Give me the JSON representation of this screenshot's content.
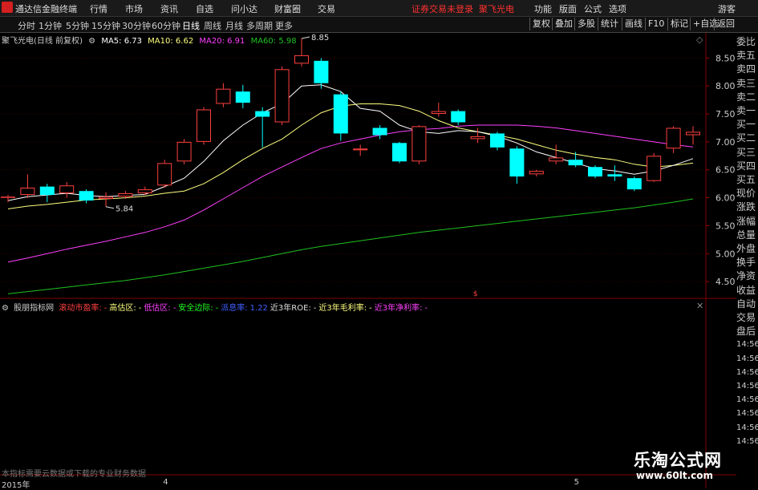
{
  "app": {
    "title": "通达信金融终端",
    "menu": [
      "行情",
      "市场",
      "资讯",
      "交易"
    ],
    "menu2": [
      "自选",
      "问小达",
      "财富圈",
      "交易"
    ],
    "warning": "证券交易未登录",
    "stock_name": "聚飞光电",
    "right_menu": [
      "功能",
      "版面",
      "公式",
      "选项"
    ],
    "guest": "游客"
  },
  "periods": {
    "items": [
      "分时",
      "1分钟",
      "5分钟",
      "15分钟",
      "30分钟",
      "60分钟",
      "日线",
      "周线",
      "月线",
      "多周期",
      "更多"
    ],
    "active": "日线"
  },
  "toolbar": {
    "buttons": [
      "复权",
      "叠加",
      "多股",
      "统计",
      "画线",
      "F10",
      "标记",
      "+自选",
      "返回"
    ]
  },
  "chart_header": {
    "name": "聚飞光电(日线 前复权)",
    "ma5": "MA5: 6.73",
    "ma10": "MA10: 6.62",
    "ma20": "MA20: 6.91",
    "ma60": "MA60: 5.98"
  },
  "colors": {
    "up": "#ff4040",
    "down": "#00ffff",
    "ma5": "#ffffff",
    "ma10": "#ffff80",
    "ma20": "#ff40ff",
    "ma60": "#20c020",
    "grid": "#400000"
  },
  "chart_data": {
    "type": "candlestick",
    "ylim": [
      4.2,
      8.95
    ],
    "yticks": [
      4.5,
      5.0,
      5.5,
      6.0,
      6.5,
      7.0,
      7.5,
      8.0,
      8.5
    ],
    "ytick_labels": [
      "4.50",
      "5.00",
      "5.50",
      "6.00",
      "6.50",
      "7.00",
      "7.50",
      "8.00",
      "8.50"
    ],
    "annotations": [
      {
        "text": "8.85",
        "index": 15,
        "value": 8.85
      },
      {
        "text": "5.84",
        "index": 5,
        "value": 5.84
      }
    ],
    "candles": [
      {
        "o": 6.0,
        "h": 6.05,
        "l": 5.92,
        "c": 6.02
      },
      {
        "o": 6.05,
        "h": 6.42,
        "l": 6.0,
        "c": 6.18
      },
      {
        "o": 6.2,
        "h": 6.25,
        "l": 5.92,
        "c": 6.05
      },
      {
        "o": 6.08,
        "h": 6.28,
        "l": 6.0,
        "c": 6.22
      },
      {
        "o": 6.12,
        "h": 6.15,
        "l": 5.9,
        "c": 5.95
      },
      {
        "o": 5.98,
        "h": 6.1,
        "l": 5.84,
        "c": 6.02
      },
      {
        "o": 6.02,
        "h": 6.12,
        "l": 5.98,
        "c": 6.08
      },
      {
        "o": 6.08,
        "h": 6.2,
        "l": 6.05,
        "c": 6.15
      },
      {
        "o": 6.22,
        "h": 6.68,
        "l": 6.18,
        "c": 6.62
      },
      {
        "o": 6.65,
        "h": 7.05,
        "l": 6.6,
        "c": 7.0
      },
      {
        "o": 7.0,
        "h": 7.62,
        "l": 6.95,
        "c": 7.58
      },
      {
        "o": 7.68,
        "h": 8.05,
        "l": 7.62,
        "c": 7.95
      },
      {
        "o": 7.9,
        "h": 8.02,
        "l": 7.6,
        "c": 7.7
      },
      {
        "o": 7.55,
        "h": 7.62,
        "l": 6.9,
        "c": 7.45
      },
      {
        "o": 7.35,
        "h": 8.35,
        "l": 7.3,
        "c": 8.3
      },
      {
        "o": 8.4,
        "h": 8.85,
        "l": 8.35,
        "c": 8.55
      },
      {
        "o": 8.45,
        "h": 8.5,
        "l": 7.95,
        "c": 8.05
      },
      {
        "o": 7.85,
        "h": 7.9,
        "l": 7.02,
        "c": 7.15
      },
      {
        "o": 6.85,
        "h": 6.95,
        "l": 6.75,
        "c": 6.88
      },
      {
        "o": 7.25,
        "h": 7.3,
        "l": 7.05,
        "c": 7.12
      },
      {
        "o": 6.98,
        "h": 7.0,
        "l": 6.62,
        "c": 6.65
      },
      {
        "o": 6.65,
        "h": 7.3,
        "l": 6.6,
        "c": 7.28
      },
      {
        "o": 7.5,
        "h": 7.7,
        "l": 7.45,
        "c": 7.55
      },
      {
        "o": 7.55,
        "h": 7.58,
        "l": 7.3,
        "c": 7.35
      },
      {
        "o": 7.05,
        "h": 7.25,
        "l": 6.98,
        "c": 7.1
      },
      {
        "o": 7.15,
        "h": 7.18,
        "l": 6.85,
        "c": 6.9
      },
      {
        "o": 6.88,
        "h": 6.92,
        "l": 6.25,
        "c": 6.38
      },
      {
        "o": 6.42,
        "h": 6.5,
        "l": 6.38,
        "c": 6.48
      },
      {
        "o": 6.65,
        "h": 6.95,
        "l": 6.6,
        "c": 6.72
      },
      {
        "o": 6.68,
        "h": 6.82,
        "l": 6.55,
        "c": 6.58
      },
      {
        "o": 6.55,
        "h": 6.58,
        "l": 6.35,
        "c": 6.38
      },
      {
        "o": 6.42,
        "h": 6.58,
        "l": 6.3,
        "c": 6.38
      },
      {
        "o": 6.35,
        "h": 6.38,
        "l": 6.12,
        "c": 6.15
      },
      {
        "o": 6.3,
        "h": 6.8,
        "l": 6.28,
        "c": 6.75
      },
      {
        "o": 6.88,
        "h": 7.28,
        "l": 6.8,
        "c": 7.25
      },
      {
        "o": 7.12,
        "h": 7.28,
        "l": 6.95,
        "c": 7.18
      }
    ],
    "ma5": [
      5.95,
      6.02,
      6.05,
      6.08,
      6.04,
      6.02,
      6.04,
      6.06,
      6.2,
      6.35,
      6.65,
      7.02,
      7.3,
      7.52,
      7.68,
      8.0,
      8.02,
      7.9,
      7.6,
      7.55,
      7.3,
      7.18,
      7.15,
      7.2,
      7.18,
      7.1,
      6.98,
      6.82,
      6.72,
      6.62,
      6.52,
      6.48,
      6.42,
      6.48,
      6.58,
      6.7
    ],
    "ma10": [
      5.8,
      5.85,
      5.88,
      5.92,
      5.96,
      5.98,
      6.0,
      6.03,
      6.08,
      6.12,
      6.25,
      6.45,
      6.68,
      6.88,
      7.05,
      7.3,
      7.52,
      7.64,
      7.68,
      7.68,
      7.65,
      7.55,
      7.38,
      7.25,
      7.18,
      7.12,
      7.05,
      6.95,
      6.85,
      6.78,
      6.72,
      6.68,
      6.6,
      6.55,
      6.58,
      6.62
    ],
    "ma20": [
      4.85,
      4.92,
      5.0,
      5.08,
      5.15,
      5.22,
      5.3,
      5.38,
      5.48,
      5.6,
      5.78,
      5.98,
      6.18,
      6.38,
      6.55,
      6.72,
      6.88,
      6.98,
      7.05,
      7.12,
      7.18,
      7.22,
      7.24,
      7.28,
      7.3,
      7.3,
      7.3,
      7.28,
      7.25,
      7.2,
      7.15,
      7.1,
      7.05,
      7.0,
      6.95,
      6.91
    ],
    "ma60": [
      4.28,
      4.32,
      4.36,
      4.4,
      4.44,
      4.48,
      4.52,
      4.57,
      4.62,
      4.68,
      4.74,
      4.8,
      4.86,
      4.93,
      5.0,
      5.07,
      5.13,
      5.18,
      5.23,
      5.28,
      5.33,
      5.38,
      5.42,
      5.46,
      5.5,
      5.54,
      5.58,
      5.62,
      5.66,
      5.7,
      5.74,
      5.78,
      5.82,
      5.87,
      5.92,
      5.98
    ],
    "xaxis_labels": [
      {
        "text": "2015年",
        "index": 0
      },
      {
        "text": "4",
        "index": 8
      },
      {
        "text": "5",
        "index": 29
      }
    ]
  },
  "right_panel": {
    "labels": [
      "委比",
      "卖五",
      "卖四",
      "卖三",
      "卖二",
      "卖一",
      "买一",
      "买二",
      "买三",
      "买四",
      "买五",
      "现价",
      "涨跌",
      "涨幅",
      "总量",
      "外盘",
      "换手",
      "净资",
      "收益",
      "自动",
      "交易",
      "盘后",
      "14:56",
      "14:56",
      "14:56",
      "14:56",
      "14:56",
      "14:56",
      "14:56",
      "14:56"
    ]
  },
  "indicator": {
    "name": "股朋指标网",
    "items": [
      {
        "text": "滚动市盈率:",
        "color": "#ff4040"
      },
      {
        "text": "-",
        "color": "#ff4040"
      },
      {
        "text": "高估区:",
        "color": "#ffff80"
      },
      {
        "text": "-",
        "color": "#ffff80"
      },
      {
        "text": "低估区:",
        "color": "#ff40ff"
      },
      {
        "text": "-",
        "color": "#ff40ff"
      },
      {
        "text": "安全边际:",
        "color": "#20ff20"
      },
      {
        "text": "-",
        "color": "#20ff20"
      },
      {
        "text": "派息率:",
        "color": "#4060ff"
      },
      {
        "text": "1.22",
        "color": "#4060ff"
      },
      {
        "text": "近3年ROE:",
        "color": "#dddddd"
      },
      {
        "text": "-",
        "color": "#dddddd"
      },
      {
        "text": "近3年毛利率:",
        "color": "#ffff80"
      },
      {
        "text": "-",
        "color": "#ffff80"
      },
      {
        "text": "近3年净利率:",
        "color": "#ff40ff"
      },
      {
        "text": "-",
        "color": "#ff40ff"
      }
    ]
  },
  "note": "本指标需要云数据或下载的专业财务数据",
  "watermark": {
    "title": "乐淘公式网",
    "url": "www.60lt.com"
  },
  "small_marker": "$"
}
